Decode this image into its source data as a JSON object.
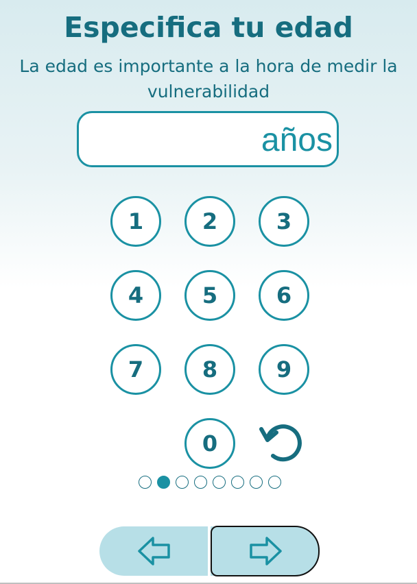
{
  "header": {
    "title": "Especifica tu edad",
    "subtitle": "La edad es importante a la hora de medir la vulnerabilidad"
  },
  "age_input": {
    "value": "",
    "unit": "años"
  },
  "keypad": {
    "keys": [
      "1",
      "2",
      "3",
      "4",
      "5",
      "6",
      "7",
      "8",
      "9",
      "0"
    ],
    "reset_icon": "undo-icon"
  },
  "progress": {
    "total_steps": 8,
    "current_step": 2
  },
  "navigation": {
    "prev_icon": "arrow-left-icon",
    "next_icon": "arrow-right-icon"
  },
  "colors": {
    "primary": "#166d7f",
    "accent": "#1a91a3",
    "nav_bg": "#b7dfe7"
  }
}
